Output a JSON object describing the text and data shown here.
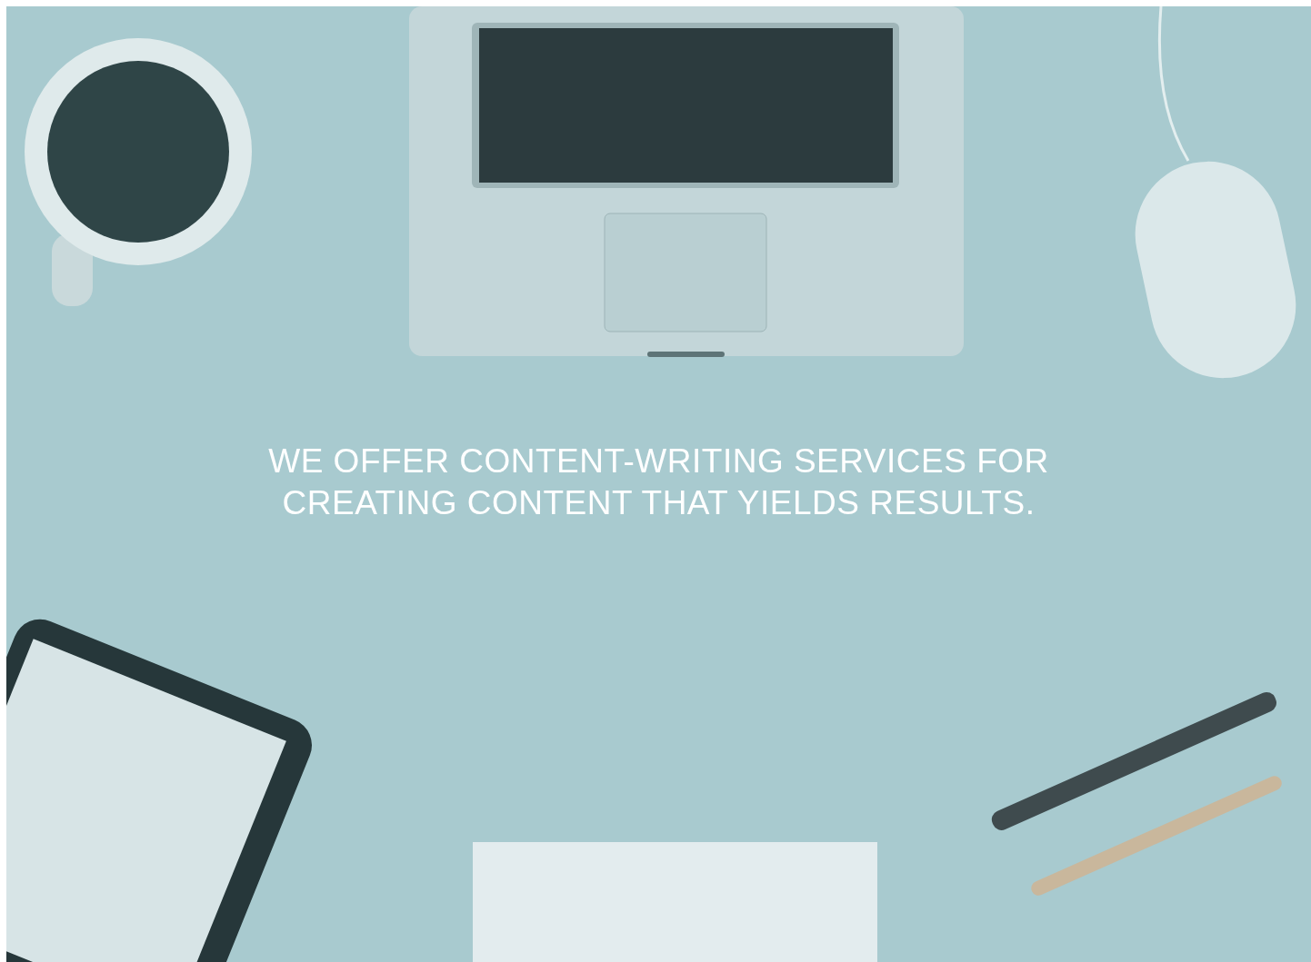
{
  "hero": {
    "headline": "WE OFFER CONTENT-WRITING SERVICES FOR CREATING CONTENT THAT YIELDS RESULTS."
  }
}
